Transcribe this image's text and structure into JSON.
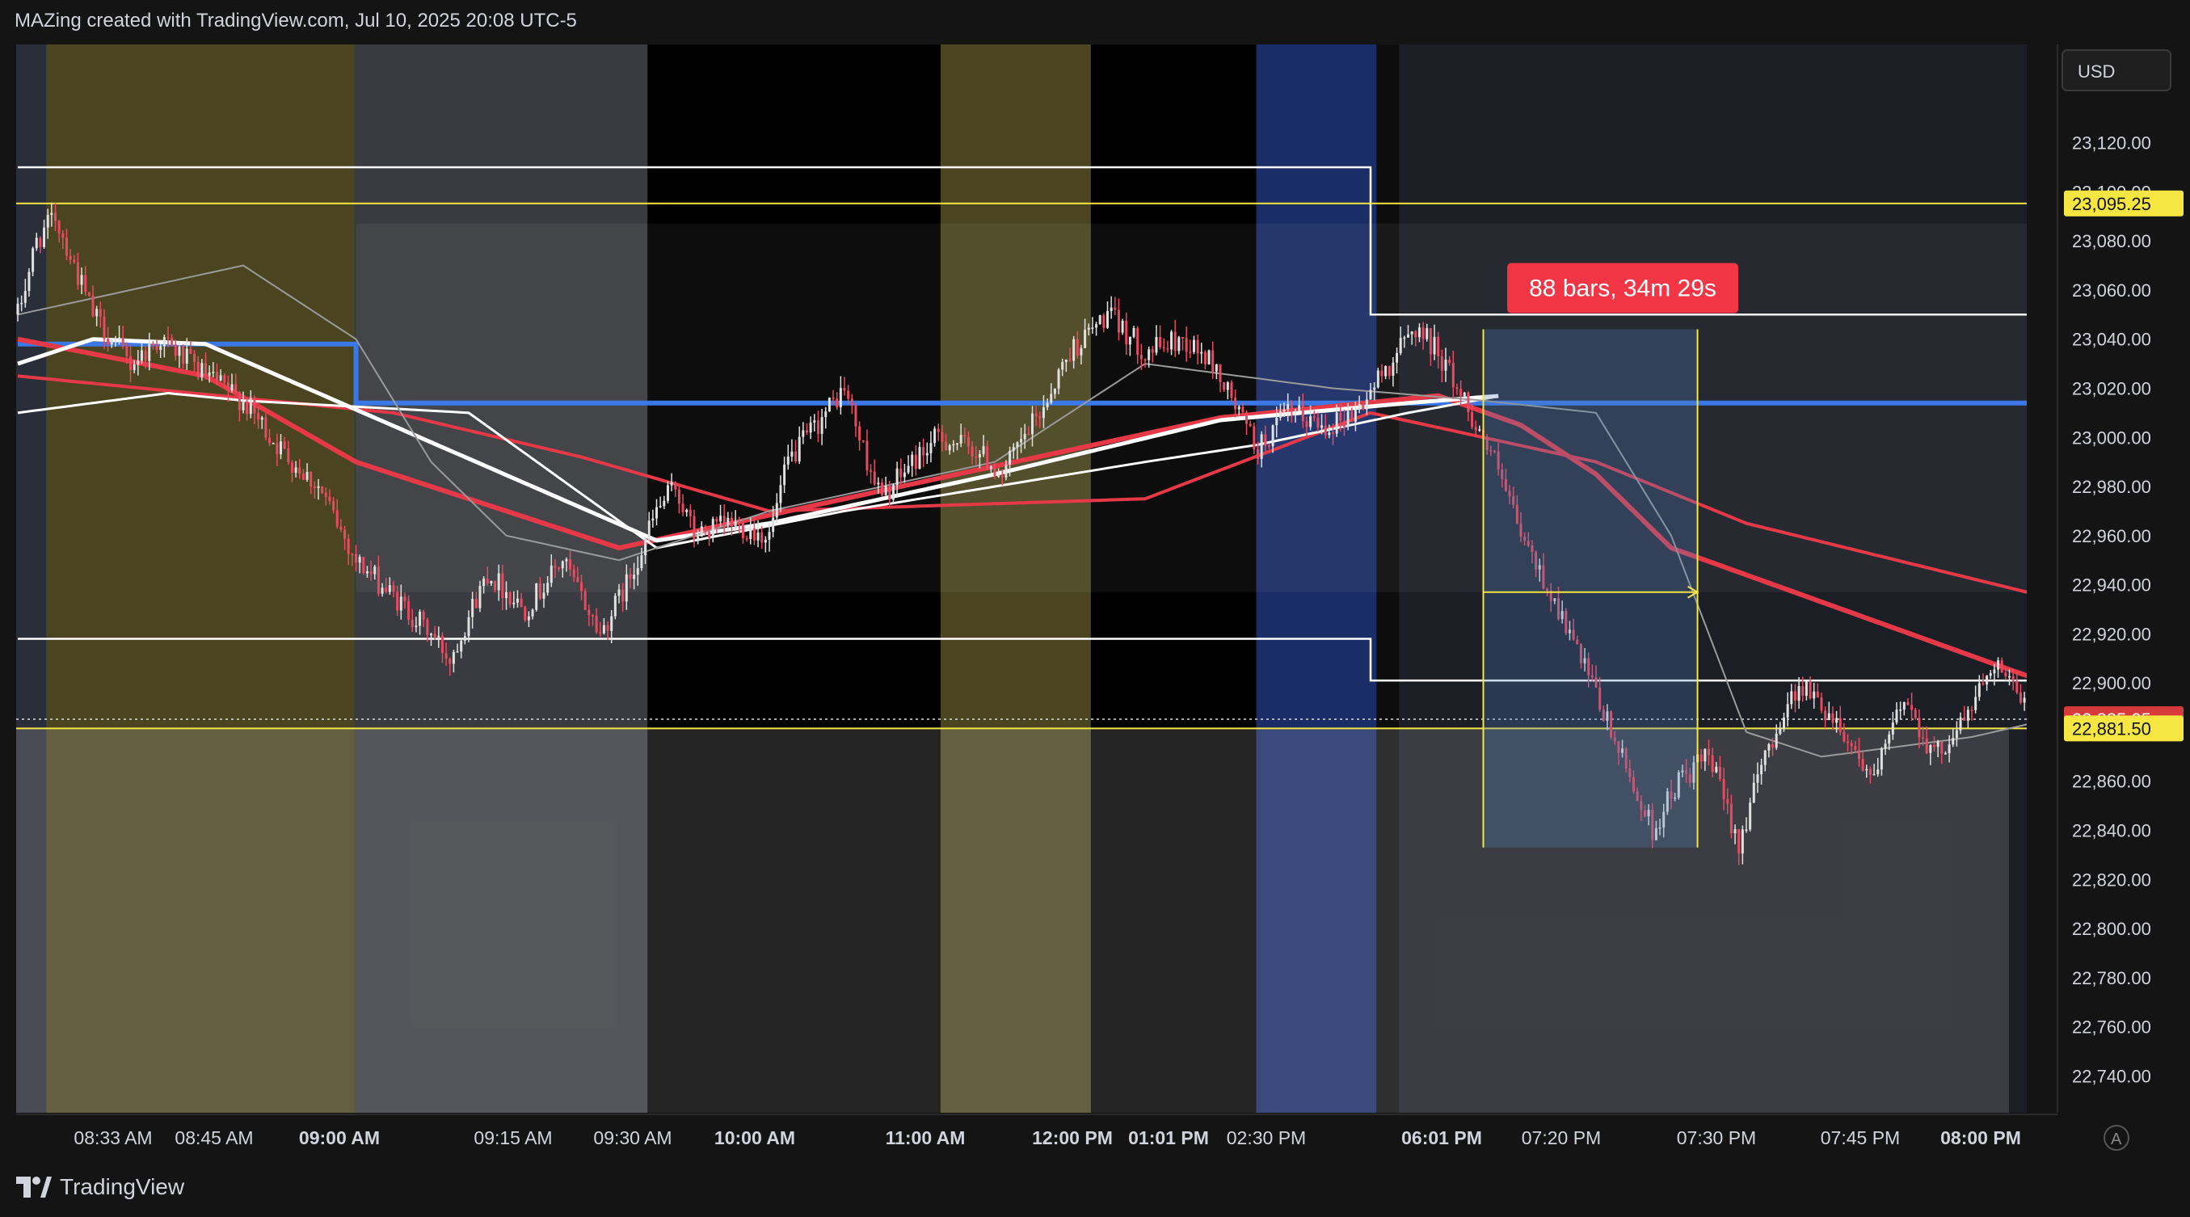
{
  "header": {
    "attribution": "MAZing created with TradingView.com, Jul 10, 2025 20:08 UTC-5"
  },
  "footer": {
    "logo_text": "TradingView"
  },
  "price_axis": {
    "currency": "USD",
    "auto_button": "A"
  },
  "colors": {
    "background": "#141414",
    "pane": "#000000",
    "bull": "#e0e0e0",
    "bear": "#e84a5f",
    "ma_red": "#e53948",
    "ma_white": "#ffffff",
    "level_blue": "#3b78e7",
    "level_yellow": "#f5e642",
    "measure_label_bg": "#f23645",
    "axis_text": "#d1d4dc"
  },
  "measure_tool": {
    "label": "88 bars, 34m 29s"
  },
  "badges": {
    "upper_level": "23,095.25",
    "last_price": "22,881.50",
    "hidden_level": "22,885.25"
  },
  "chart_data": {
    "type": "candlestick",
    "title": "",
    "ylim": [
      22725,
      23160
    ],
    "y_ticks": [
      23120,
      23100,
      23080,
      23060,
      23040,
      23020,
      23000,
      22980,
      22960,
      22940,
      22920,
      22900,
      22880,
      22860,
      22840,
      22820,
      22800,
      22780,
      22760,
      22740
    ],
    "y_tick_labels": [
      "23,120.00",
      "23,100.00",
      "23,080.00",
      "23,060.00",
      "23,040.00",
      "23,020.00",
      "23,000.00",
      "22,980.00",
      "22,960.00",
      "22,940.00",
      "22,920.00",
      "22,900.00",
      "",
      "22,860.00",
      "22,840.00",
      "22,820.00",
      "22,800.00",
      "22,780.00",
      "22,760.00",
      "22,740.00"
    ],
    "x_tick_labels": [
      {
        "label": "08:33 AM",
        "bold": false
      },
      {
        "label": "08:45 AM",
        "bold": false
      },
      {
        "label": "09:00 AM",
        "bold": true
      },
      {
        "label": "09:15 AM",
        "bold": false
      },
      {
        "label": "09:30 AM",
        "bold": false
      },
      {
        "label": "10:00 AM",
        "bold": true
      },
      {
        "label": "11:00 AM",
        "bold": true
      },
      {
        "label": "12:00 PM",
        "bold": true
      },
      {
        "label": "01:01 PM",
        "bold": true
      },
      {
        "label": "02:30 PM",
        "bold": false
      },
      {
        "label": "06:01 PM",
        "bold": true
      },
      {
        "label": "07:20 PM",
        "bold": false
      },
      {
        "label": "07:30 PM",
        "bold": false
      },
      {
        "label": "07:45 PM",
        "bold": false
      },
      {
        "label": "08:00 PM",
        "bold": true
      }
    ],
    "price_path_key_points": [
      [
        0,
        23050
      ],
      [
        5,
        23080
      ],
      [
        10,
        23090
      ],
      [
        15,
        23070
      ],
      [
        20,
        23050
      ],
      [
        30,
        23030
      ],
      [
        38,
        23040
      ],
      [
        50,
        23025
      ],
      [
        60,
        23015
      ],
      [
        70,
        22995
      ],
      [
        80,
        22980
      ],
      [
        90,
        22950
      ],
      [
        100,
        22935
      ],
      [
        110,
        22920
      ],
      [
        115,
        22910
      ],
      [
        125,
        22945
      ],
      [
        135,
        22930
      ],
      [
        145,
        22950
      ],
      [
        155,
        22920
      ],
      [
        162,
        22940
      ],
      [
        170,
        22970
      ],
      [
        175,
        22980
      ],
      [
        180,
        22960
      ],
      [
        190,
        22965
      ],
      [
        200,
        22960
      ],
      [
        205,
        22990
      ],
      [
        215,
        23010
      ],
      [
        220,
        23020
      ],
      [
        225,
        22995
      ],
      [
        230,
        22975
      ],
      [
        238,
        22990
      ],
      [
        245,
        23000
      ],
      [
        255,
        22995
      ],
      [
        262,
        22985
      ],
      [
        272,
        23010
      ],
      [
        280,
        23035
      ],
      [
        290,
        23050
      ],
      [
        300,
        23035
      ],
      [
        310,
        23040
      ],
      [
        318,
        23030
      ],
      [
        325,
        23010
      ],
      [
        330,
        22995
      ],
      [
        338,
        23010
      ],
      [
        348,
        23005
      ],
      [
        356,
        23010
      ],
      [
        365,
        23030
      ],
      [
        372,
        23045
      ],
      [
        378,
        23035
      ],
      [
        385,
        23015
      ],
      [
        393,
        22990
      ],
      [
        400,
        22960
      ],
      [
        410,
        22930
      ],
      [
        420,
        22895
      ],
      [
        428,
        22865
      ],
      [
        435,
        22840
      ],
      [
        442,
        22860
      ],
      [
        450,
        22870
      ],
      [
        458,
        22835
      ],
      [
        466,
        22875
      ],
      [
        474,
        22900
      ],
      [
        484,
        22885
      ],
      [
        494,
        22860
      ],
      [
        502,
        22895
      ],
      [
        510,
        22870
      ],
      [
        518,
        22885
      ],
      [
        526,
        22910
      ],
      [
        534,
        22890
      ],
      [
        540,
        22883
      ]
    ],
    "series": [
      {
        "name": "",
        "color": "#e53948",
        "key_points": [
          [
            0,
            23025
          ],
          [
            100,
            23010
          ],
          [
            150,
            22992
          ],
          [
            200,
            22970
          ],
          [
            300,
            22975
          ],
          [
            360,
            23010
          ],
          [
            420,
            22990
          ],
          [
            460,
            22965
          ],
          [
            540,
            22935
          ]
        ]
      },
      {
        "name": "",
        "color": "#e53948",
        "key_points": [
          [
            0,
            23040
          ],
          [
            50,
            23025
          ],
          [
            90,
            22990
          ],
          [
            130,
            22970
          ],
          [
            160,
            22955
          ],
          [
            250,
            22985
          ],
          [
            320,
            23008
          ],
          [
            378,
            23017
          ],
          [
            400,
            23005
          ],
          [
            420,
            22985
          ],
          [
            440,
            22955
          ],
          [
            540,
            22900
          ]
        ]
      },
      {
        "name": "",
        "color": "#ffffff",
        "key_points": [
          [
            0,
            23010
          ],
          [
            40,
            23018
          ],
          [
            60,
            23015
          ],
          [
            120,
            23010
          ],
          [
            170,
            22955
          ],
          [
            220,
            22970
          ],
          [
            300,
            22990
          ],
          [
            330,
            22997
          ],
          [
            370,
            23010
          ],
          [
            395,
            23017
          ]
        ]
      },
      {
        "name": "",
        "color": "#ffffff",
        "key_points": [
          [
            0,
            23030
          ],
          [
            20,
            23040
          ],
          [
            50,
            23038
          ],
          [
            170,
            22958
          ],
          [
            200,
            22965
          ],
          [
            260,
            22985
          ],
          [
            320,
            23007
          ],
          [
            370,
            23014
          ],
          [
            395,
            23017
          ]
        ]
      },
      {
        "name": "",
        "color": "#9a9a9a",
        "key_points": [
          [
            0,
            23050
          ],
          [
            60,
            23070
          ],
          [
            90,
            23040
          ],
          [
            110,
            22990
          ],
          [
            130,
            22960
          ],
          [
            160,
            22950
          ],
          [
            200,
            22970
          ],
          [
            260,
            22990
          ],
          [
            300,
            23030
          ],
          [
            350,
            23020
          ],
          [
            390,
            23015
          ],
          [
            420,
            23010
          ],
          [
            440,
            22960
          ],
          [
            460,
            22880
          ],
          [
            480,
            22870
          ],
          [
            520,
            22878
          ],
          [
            540,
            22885
          ]
        ]
      }
    ],
    "levels": [
      {
        "type": "step",
        "color": "#ffffff",
        "segments": [
          [
            0,
            23110
          ],
          [
            360,
            23110
          ],
          [
            360,
            23050
          ],
          [
            540,
            23050
          ]
        ]
      },
      {
        "type": "step",
        "color": "#ffffff",
        "segments": [
          [
            0,
            22918
          ],
          [
            360,
            22918
          ],
          [
            360,
            22901
          ],
          [
            540,
            22901
          ]
        ]
      },
      {
        "type": "step",
        "color": "#3b78e7",
        "segments": [
          [
            0,
            23038
          ],
          [
            90,
            23038
          ],
          [
            90,
            23014
          ],
          [
            545,
            23014
          ]
        ]
      },
      {
        "type": "horizontal",
        "color": "#f5e642",
        "value": 23095.25
      },
      {
        "type": "horizontal",
        "color": "#f5e642",
        "value": 22881.5
      }
    ],
    "sessions": [
      {
        "from": 0,
        "to": 8,
        "color": "#2a2e39"
      },
      {
        "from": 8,
        "to": 90,
        "color": "#4a4520"
      },
      {
        "from": 90,
        "to": 168,
        "color": "#3a3b40"
      },
      {
        "from": 168,
        "to": 246,
        "color": "#000000"
      },
      {
        "from": 246,
        "to": 286,
        "color": "#4a4520"
      },
      {
        "from": 286,
        "to": 330,
        "color": "#000000"
      },
      {
        "from": 330,
        "to": 362,
        "color": "#1a2d66"
      },
      {
        "from": 362,
        "to": 368,
        "color": "#0d0d0d"
      },
      {
        "from": 368,
        "to": 545,
        "color": "#1c1e25"
      }
    ],
    "measure_range": {
      "from_bar": 390,
      "to_bar": 447,
      "low": 22833,
      "high": 23044
    }
  }
}
